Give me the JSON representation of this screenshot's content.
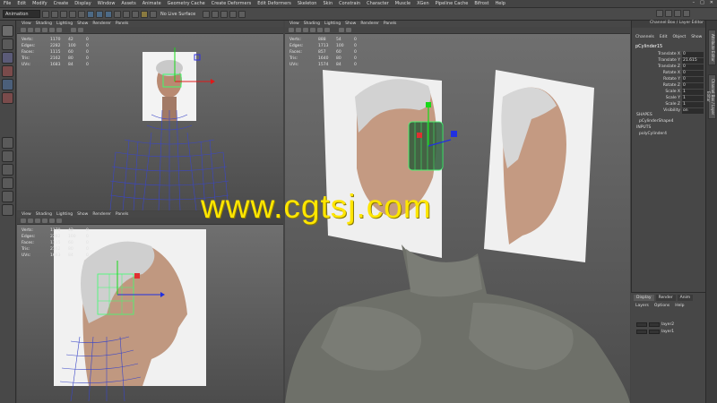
{
  "menubar": {
    "items": [
      "File",
      "Edit",
      "Modify",
      "Create",
      "Display",
      "Window",
      "Assets",
      "Animate",
      "Geometry Cache",
      "Create Deformers",
      "Edit Deformers",
      "Skeleton",
      "Skin",
      "Constrain",
      "Character",
      "Muscle",
      "XGen",
      "Pipeline Cache",
      "Bifrost",
      "Help"
    ]
  },
  "shelf": {
    "mode": "Animation",
    "live_surface": "No Live Surface"
  },
  "panel_menu": {
    "items": [
      "View",
      "Shading",
      "Lighting",
      "Show",
      "Renderer",
      "Panels"
    ]
  },
  "hud": {
    "labels": [
      "Verts:",
      "Edges:",
      "Faces:",
      "Tris:",
      "UVs:"
    ],
    "top_left": {
      "col1": [
        "1170",
        "2282",
        "1115",
        "2162",
        "1683"
      ],
      "col2": [
        "42",
        "100",
        "60",
        "80",
        "84"
      ],
      "col3": [
        "0",
        "0",
        "0",
        "0",
        "0"
      ]
    },
    "right": {
      "col1": [
        "888",
        "1713",
        "857",
        "1640",
        "1574"
      ],
      "col2": [
        "54",
        "100",
        "60",
        "80",
        "84"
      ],
      "col3": [
        "0",
        "0",
        "0",
        "0",
        "0"
      ]
    },
    "bottom_left": {
      "col1": [
        "1170",
        "2282",
        "1115",
        "2162",
        "1683"
      ],
      "col2": [
        "42",
        "100",
        "60",
        "80",
        "84"
      ],
      "col3": [
        "0",
        "0",
        "0",
        "0",
        "0"
      ]
    }
  },
  "watermark": "www.cgtsj.com",
  "channel_box": {
    "title": "Channel Box / Layer Editor",
    "menu": [
      "Channels",
      "Edit",
      "Object",
      "Show"
    ],
    "object": "pCylinder15",
    "attributes": [
      {
        "label": "Translate X",
        "value": "0"
      },
      {
        "label": "Translate Y",
        "value": "21.615"
      },
      {
        "label": "Translate Z",
        "value": "0"
      },
      {
        "label": "Rotate X",
        "value": "0"
      },
      {
        "label": "Rotate Y",
        "value": "0"
      },
      {
        "label": "Rotate Z",
        "value": "0"
      },
      {
        "label": "Scale X",
        "value": "1"
      },
      {
        "label": "Scale Y",
        "value": "1"
      },
      {
        "label": "Scale Z",
        "value": "1"
      },
      {
        "label": "Visibility",
        "value": "on"
      }
    ],
    "shapes_header": "SHAPES",
    "shape": "pCylinderShape4",
    "inputs_header": "INPUTS",
    "input": "polyCylinder4"
  },
  "side_tabs": [
    "Attribute Editor",
    "Channel Box / Layer Editor"
  ],
  "layer_editor": {
    "tabs": [
      "Display",
      "Render",
      "Anim"
    ],
    "menu": [
      "Layers",
      "Options",
      "Help"
    ],
    "layers": [
      "layer2",
      "layer1"
    ]
  },
  "colors": {
    "bg": "#444444",
    "viewport": "#626262",
    "watermark": "#ffe600",
    "wire": "#3c46c8",
    "selection": "#3cff6e"
  }
}
